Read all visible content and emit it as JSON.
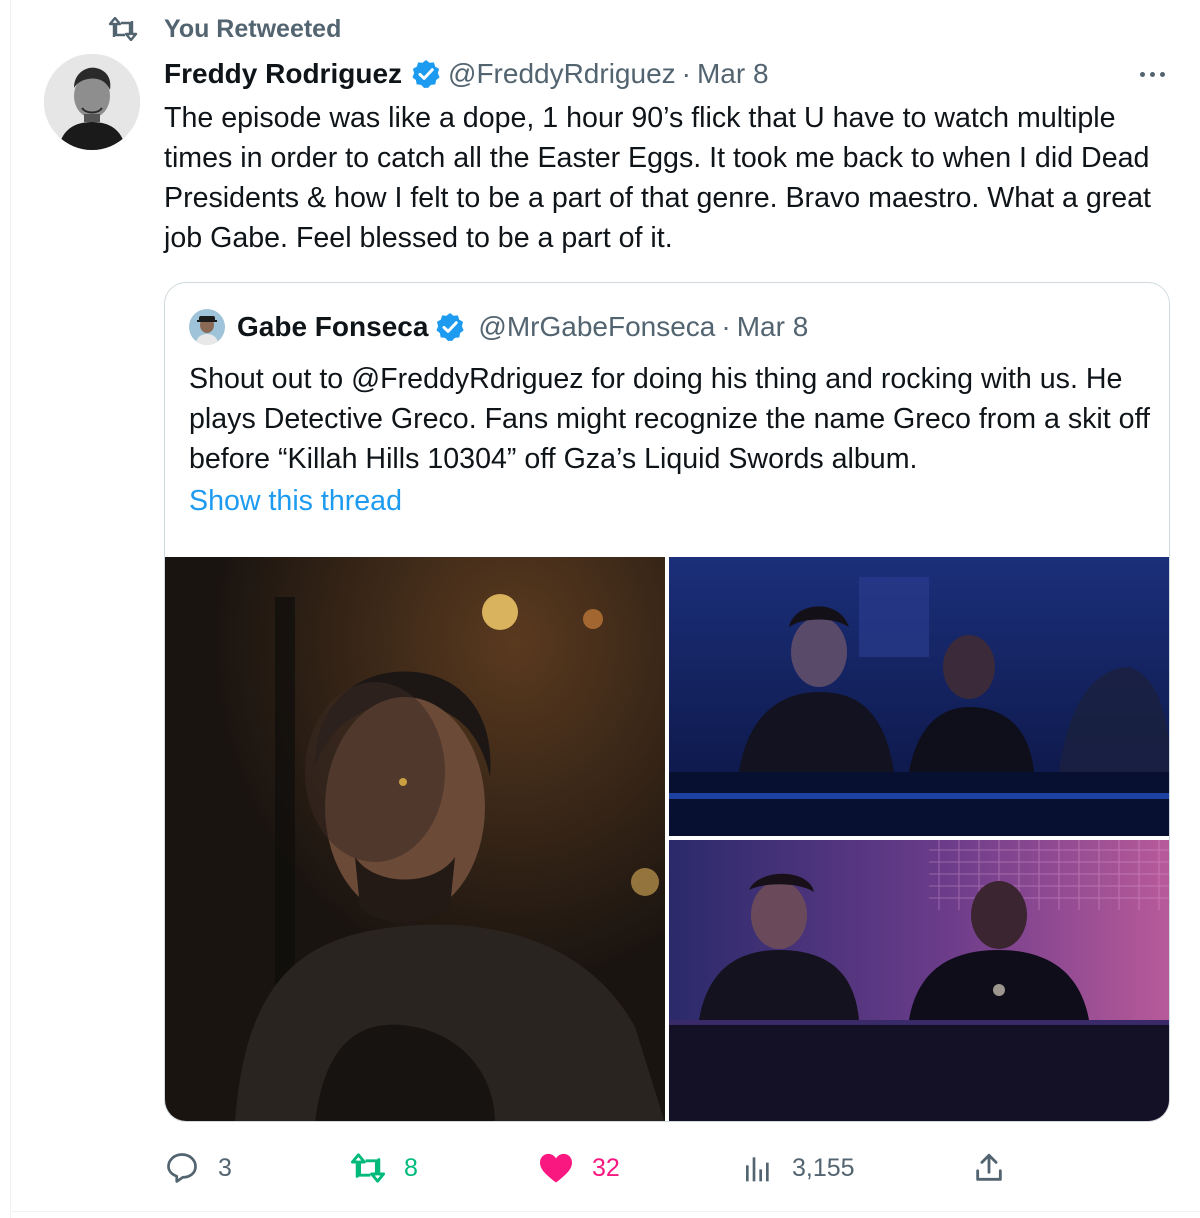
{
  "retweet_label": "You Retweeted",
  "tweet": {
    "author_name": "Freddy Rodriguez",
    "handle": "@FreddyRdriguez",
    "separator": "·",
    "date": "Mar 8",
    "text": "The episode was like a dope, 1 hour 90’s flick that U have to watch multiple times in order to catch all the Easter Eggs. It took me back to when I did Dead Presidents & how I felt to be a part of that genre. Bravo maestro. What a great job Gabe. Feel blessed to be a part of it.",
    "verified": true
  },
  "quoted_tweet": {
    "author_name": "Gabe Fonseca",
    "handle": "@MrGabeFonseca",
    "separator": "·",
    "date": "Mar 8",
    "text": "Shout out to @FreddyRdriguez  for doing his thing and rocking with us. He plays Detective Greco. Fans might recognize the name Greco from a skit off before “Killah Hills 10304” off Gza’s Liquid Swords album.",
    "show_thread_label": "Show this thread",
    "verified": true
  },
  "actions": {
    "replies": "3",
    "retweets": "8",
    "likes": "32",
    "views": "3,155"
  },
  "icons": {
    "retweet_header": "retweet-icon",
    "verified": "verified-badge-icon",
    "more": "more-icon",
    "reply": "reply-icon",
    "retweet": "retweet-icon",
    "like": "heart-icon",
    "views": "views-icon",
    "share": "share-icon"
  },
  "colors": {
    "accent": "#1d9bf0",
    "secondary_text": "#536471",
    "retweet_active": "#00ba7c",
    "like_active": "#f91880"
  }
}
